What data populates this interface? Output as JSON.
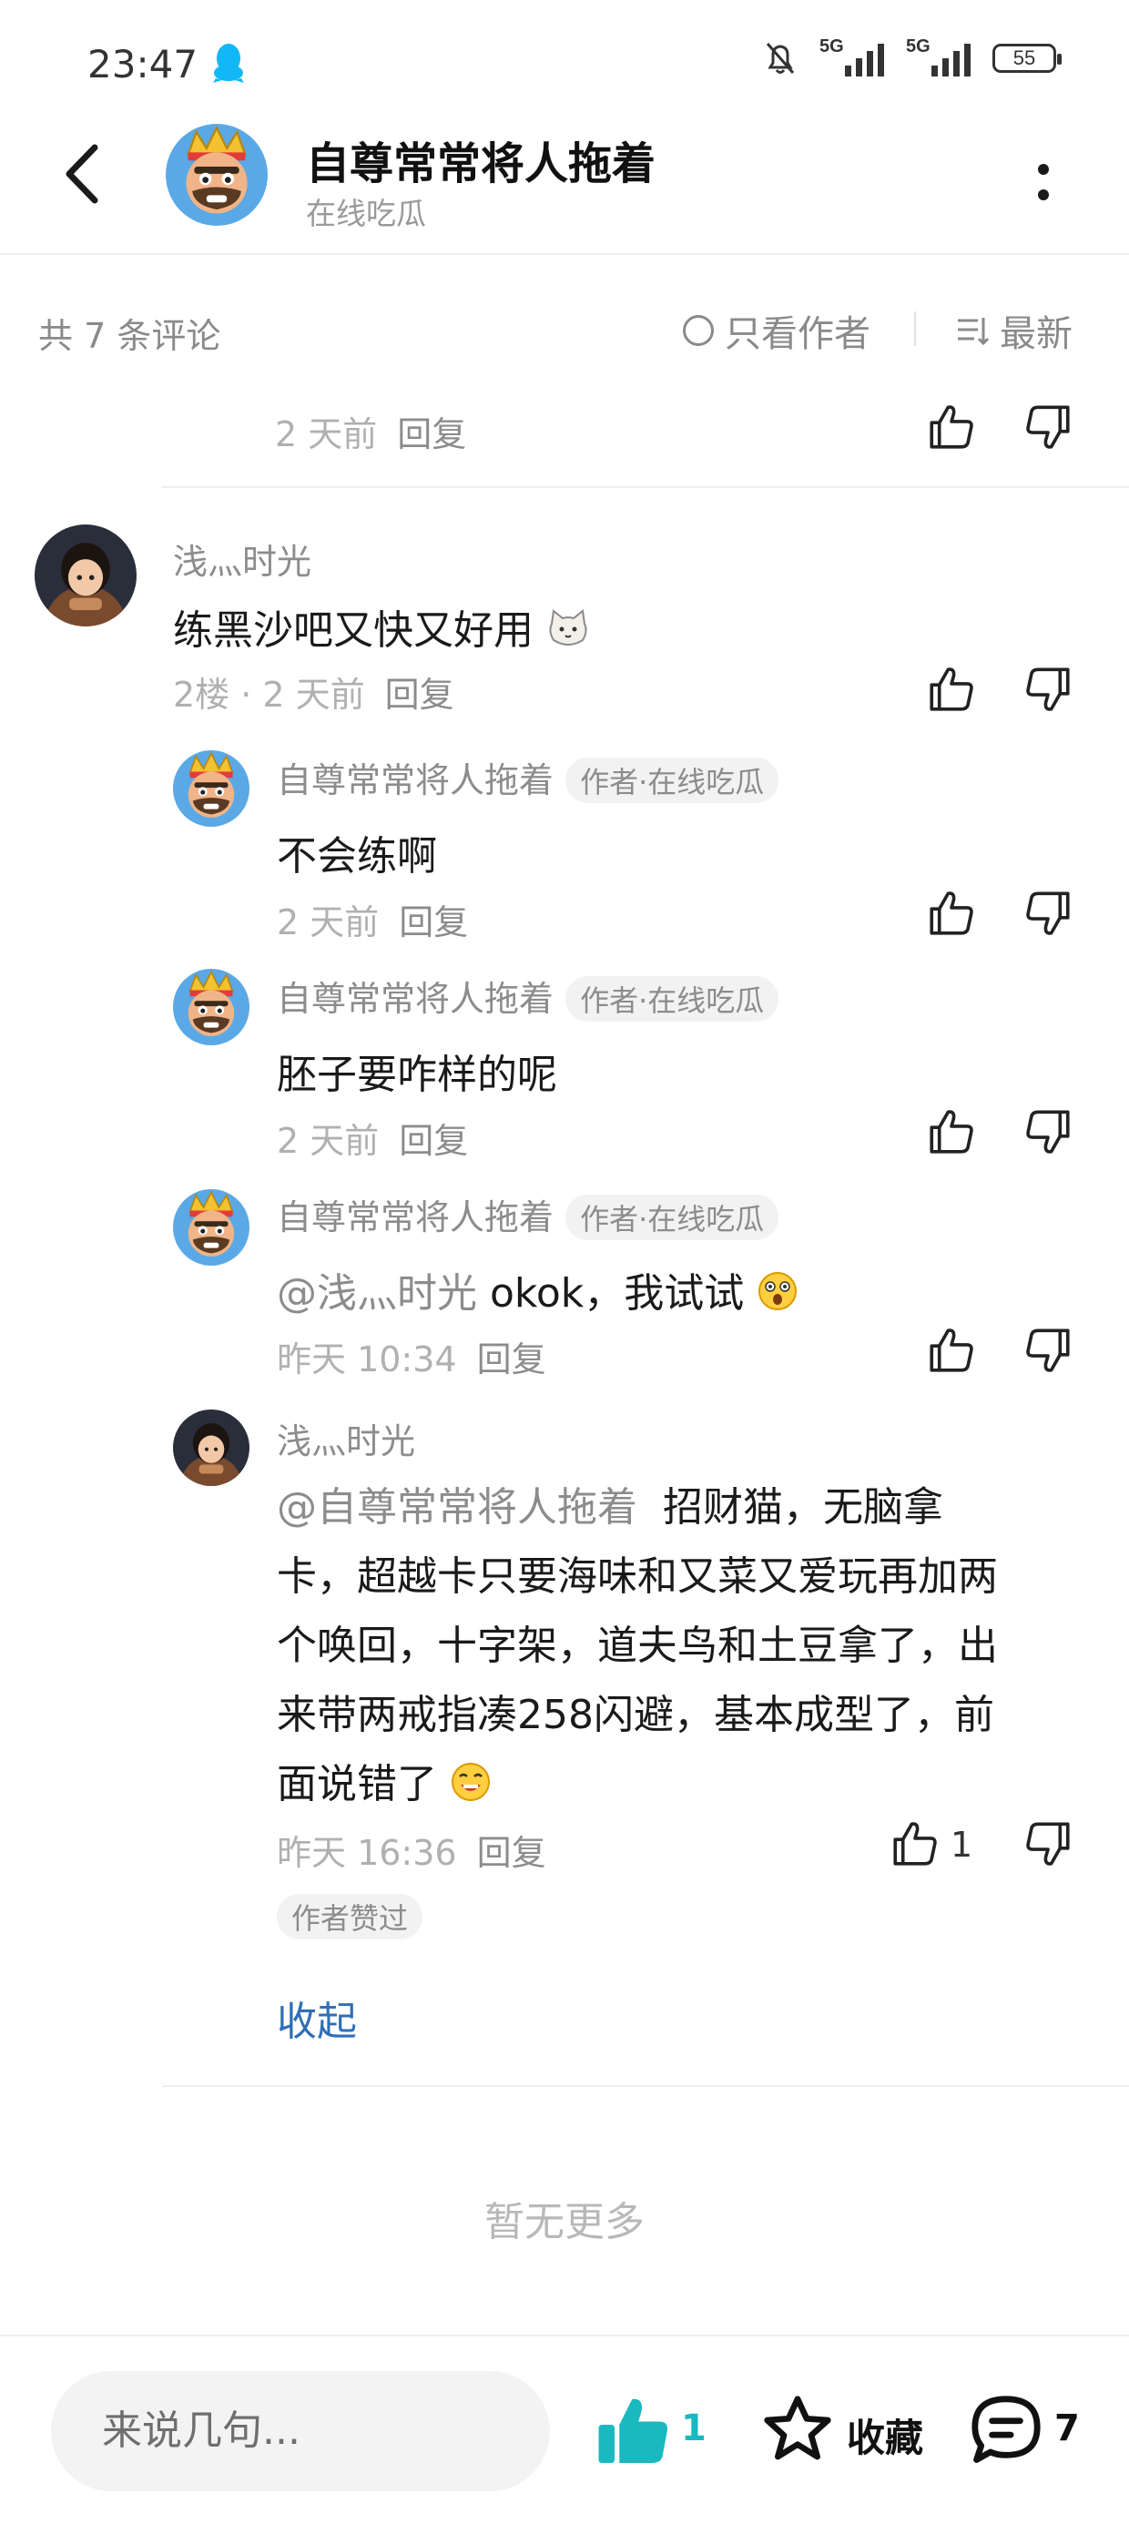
{
  "status": {
    "time": "23:47",
    "signal1": "5G",
    "signal2": "5G",
    "battery": "55"
  },
  "header": {
    "title": "自尊常常将人拖着",
    "subtitle": "在线吃瓜"
  },
  "filter": {
    "count": "共 7 条评论",
    "only_author": "只看作者",
    "sort": "最新"
  },
  "prev_comment": {
    "time": "2 天前",
    "reply": "回复"
  },
  "comment": {
    "user": "浅灬时光",
    "text": "练黑沙吧又快又好用",
    "floor": "2楼 · 2 天前",
    "reply": "回复",
    "replies": [
      {
        "user": "自尊常常将人拖着",
        "badge": "作者·在线吃瓜",
        "mention": "",
        "text": "不会练啊",
        "time": "2 天前",
        "reply": "回复"
      },
      {
        "user": "自尊常常将人拖着",
        "badge": "作者·在线吃瓜",
        "mention": "",
        "text": "胚子要咋样的呢",
        "time": "2 天前",
        "reply": "回复"
      },
      {
        "user": "自尊常常将人拖着",
        "badge": "作者·在线吃瓜",
        "mention": "@浅灬时光",
        "text": "okok，我试试",
        "time": "昨天 10:34",
        "reply": "回复"
      }
    ],
    "last_reply": {
      "user": "浅灬时光",
      "mention": "@自尊常常将人拖着",
      "lines": [
        "招财猫，无脑拿",
        "卡，超越卡只要海味和又菜又爱玩再加两",
        "个唤回，十字架，道夫鸟和土豆拿了，出",
        "来带两戒指凑258闪避，基本成型了，前",
        "面说错了"
      ],
      "time": "昨天 16:36",
      "reply": "回复",
      "like_count": "1",
      "author_liked": "作者赞过"
    },
    "collapse": "收起"
  },
  "no_more": "暂无更多",
  "bottom": {
    "placeholder": "来说几句...",
    "like_count": "1",
    "favorite": "收藏",
    "comment_count": "7"
  },
  "colors": {
    "accent": "#19b9c0",
    "link": "#2f6fb5",
    "muted": "#8c8c8c"
  }
}
